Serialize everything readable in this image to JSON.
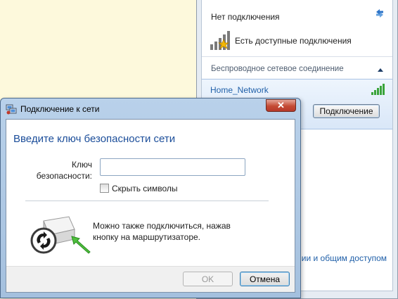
{
  "flyout": {
    "status": "Нет подключения",
    "available": "Есть доступные подключения",
    "section_title": "Беспроводное сетевое соединение",
    "network": {
      "name": "Home_Network",
      "connect_label": "Подключение"
    },
    "footer_link": "ии и общим доступом",
    "icons": [
      "refresh-icon",
      "network-available-icon",
      "collapse-icon",
      "signal-strength-icon"
    ]
  },
  "dialog": {
    "title": "Подключение к сети",
    "close_label": "✕",
    "heading": "Введите ключ безопасности сети",
    "key_label_line1": "Ключ",
    "key_label_line2": "безопасности:",
    "key_value": "",
    "hide_chars_label": "Скрыть символы",
    "hide_chars_checked": false,
    "info_line1": "Можно также подключиться, нажав",
    "info_line2": "кнопку на маршрутизаторе.",
    "ok_label": "OK",
    "cancel_label": "Отмена",
    "icons": [
      "network-icon",
      "wps-router-icon"
    ]
  },
  "colors": {
    "background": "#fdf9dc",
    "heading": "#1c4e9a",
    "link": "#1f5fa8",
    "signal": "#3aa43a"
  }
}
